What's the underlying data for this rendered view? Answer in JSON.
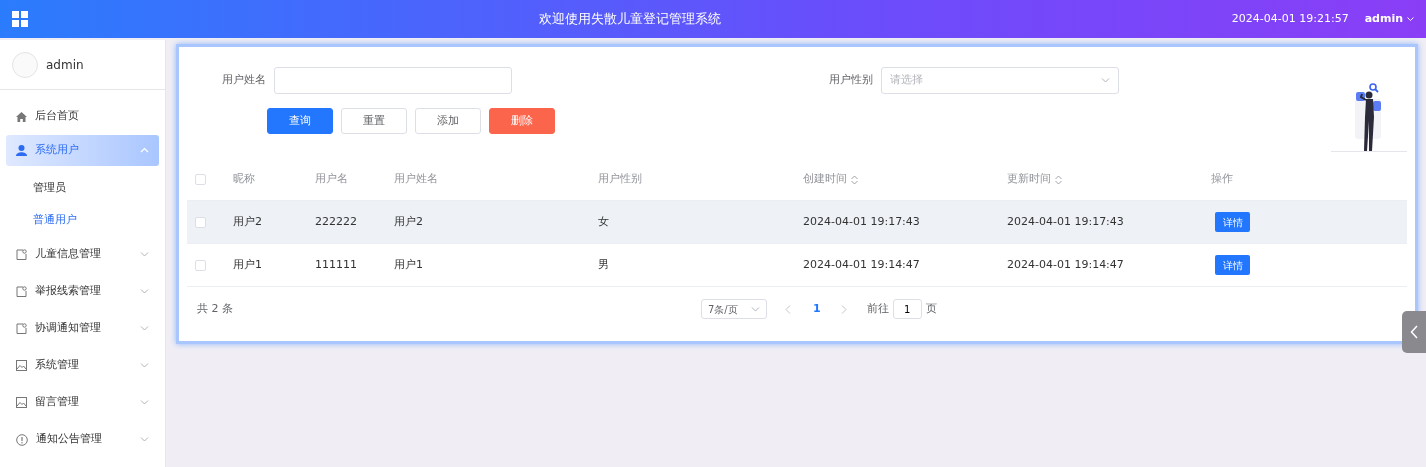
{
  "header": {
    "title": "欢迎使用失散儿童登记管理系统",
    "datetime": "2024-04-01 19:21:57",
    "user": "admin"
  },
  "sidebar": {
    "user": "admin",
    "items": [
      {
        "label": "后台首页",
        "kind": "home",
        "selected": false
      },
      {
        "label": "系统用户",
        "kind": "user",
        "selected": true,
        "expanded": true,
        "children": [
          {
            "label": "管理员",
            "selected": false
          },
          {
            "label": "普通用户",
            "selected": true
          }
        ]
      },
      {
        "label": "儿童信息管理",
        "kind": "document",
        "selected": false,
        "expanded": false
      },
      {
        "label": "举报线索管理",
        "kind": "document",
        "selected": false,
        "expanded": false
      },
      {
        "label": "协调通知管理",
        "kind": "document",
        "selected": false,
        "expanded": false
      },
      {
        "label": "系统管理",
        "kind": "image",
        "selected": false,
        "expanded": false
      },
      {
        "label": "留言管理",
        "kind": "image",
        "selected": false,
        "expanded": false
      },
      {
        "label": "通知公告管理",
        "kind": "info",
        "selected": false,
        "expanded": false
      }
    ]
  },
  "filters": [
    {
      "kind": "text",
      "label": "用户姓名"
    },
    {
      "kind": "select",
      "label": "用户性别",
      "placeholder": "请选择"
    }
  ],
  "buttons": [
    {
      "label": "查询",
      "kind": "primary"
    },
    {
      "label": "重置",
      "kind": "plain"
    },
    {
      "label": "添加",
      "kind": "plain"
    },
    {
      "label": "删除",
      "kind": "danger"
    }
  ],
  "table": {
    "all_checked": false,
    "columns": [
      {
        "label": "昵称",
        "sortable": false
      },
      {
        "label": "用户名",
        "sortable": false
      },
      {
        "label": "用户姓名",
        "sortable": false
      },
      {
        "label": "用户性别",
        "sortable": false
      },
      {
        "label": "创建时间",
        "sortable": true
      },
      {
        "label": "更新时间",
        "sortable": true
      },
      {
        "label": "操作",
        "sortable": false
      }
    ],
    "rows": [
      {
        "checked": false,
        "hovered": true,
        "cells": [
          "用户2",
          "222222",
          "用户2",
          "女",
          "2024-04-01 19:17:43",
          "2024-04-01 19:17:43"
        ],
        "action": "详情"
      },
      {
        "checked": false,
        "hovered": false,
        "cells": [
          "用户1",
          "111111",
          "用户1",
          "男",
          "2024-04-01 19:14:47",
          "2024-04-01 19:14:47"
        ],
        "action": "详情"
      }
    ]
  },
  "pagination": {
    "total": "共 2 条",
    "page_size": "7条/页",
    "pages": [
      {
        "label": "1",
        "selected": true
      }
    ],
    "goto": "前往",
    "page_input": "1",
    "suffix": "页"
  }
}
